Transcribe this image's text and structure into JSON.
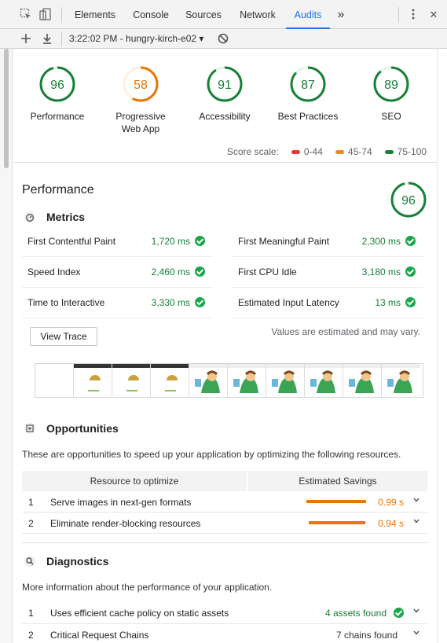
{
  "devtools": {
    "tabs": [
      "Elements",
      "Console",
      "Sources",
      "Network",
      "Audits"
    ],
    "active_tab": "Audits",
    "overflow_label": "»",
    "menu_icon": "vertical-dots-icon",
    "close_label": "✕"
  },
  "audits_toolbar": {
    "report_selector": "3:22:02 PM - hungry-kirch-e02 ▾"
  },
  "colors": {
    "pass": "#188038",
    "average": "#e67700",
    "fail": "#d93025",
    "tab_active": "#1a73e8"
  },
  "categories": [
    {
      "label": "Performance",
      "score": 96,
      "rating": "pass"
    },
    {
      "label": "Progressive Web App",
      "score": 58,
      "rating": "average"
    },
    {
      "label": "Accessibility",
      "score": 91,
      "rating": "pass"
    },
    {
      "label": "Best Practices",
      "score": 87,
      "rating": "pass"
    },
    {
      "label": "SEO",
      "score": 89,
      "rating": "pass"
    }
  ],
  "score_scale": {
    "label": "Score scale:",
    "ranges": [
      {
        "label": "0-44",
        "color": "#e8373b"
      },
      {
        "label": "45-74",
        "color": "#ef8625"
      },
      {
        "label": "75-100",
        "color": "#188038"
      }
    ]
  },
  "performance": {
    "title": "Performance",
    "score": 96,
    "metrics_title": "Metrics",
    "metrics": [
      {
        "name": "First Contentful Paint",
        "value": "1,720 ms"
      },
      {
        "name": "First Meaningful Paint",
        "value": "2,300 ms"
      },
      {
        "name": "Speed Index",
        "value": "2,460 ms"
      },
      {
        "name": "First CPU Idle",
        "value": "3,180 ms"
      },
      {
        "name": "Time to Interactive",
        "value": "3,330 ms"
      },
      {
        "name": "Estimated Input Latency",
        "value": "13 ms"
      }
    ],
    "view_trace": "View Trace",
    "estimate_note": "Values are estimated and may vary."
  },
  "opportunities": {
    "title": "Opportunities",
    "description": "These are opportunities to speed up your application by optimizing the following resources.",
    "col_resource": "Resource to optimize",
    "col_savings": "Estimated Savings",
    "rows": [
      {
        "num": "1",
        "title": "Serve images in next-gen formats",
        "savings": "0.99 s",
        "bar_fraction": 1.0
      },
      {
        "num": "2",
        "title": "Eliminate render-blocking resources",
        "savings": "0.94 s",
        "bar_fraction": 0.95
      }
    ]
  },
  "diagnostics": {
    "title": "Diagnostics",
    "description": "More information about the performance of your application.",
    "rows": [
      {
        "num": "1",
        "title": "Uses efficient cache policy on static assets",
        "detail": "4 assets found",
        "passed": true
      },
      {
        "num": "2",
        "title": "Critical Request Chains",
        "detail": "7 chains found",
        "passed": false
      }
    ]
  }
}
